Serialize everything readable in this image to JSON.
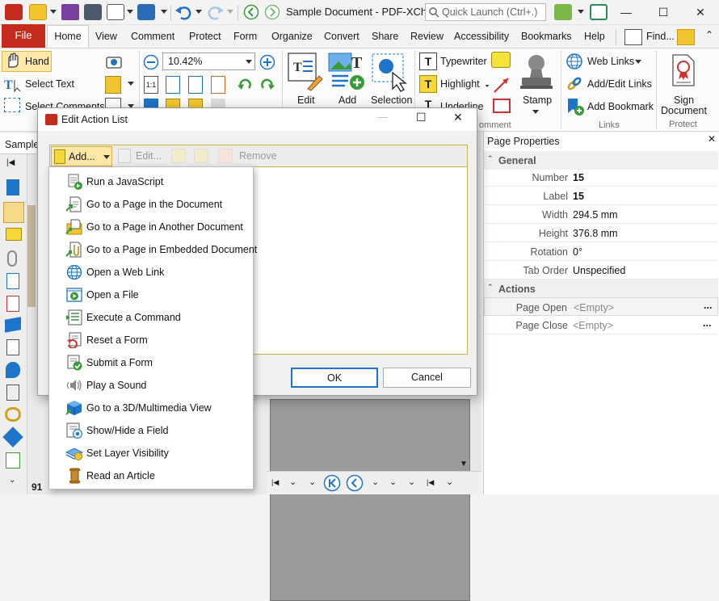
{
  "window": {
    "title": "Sample Document - PDF-XCha...",
    "quick_launch_placeholder": "Quick Launch (Ctrl+.)"
  },
  "menu_tabs": [
    "File",
    "Home",
    "View",
    "Comment",
    "Protect",
    "Form",
    "Organize",
    "Convert",
    "Share",
    "Review",
    "Accessibility",
    "Bookmarks",
    "Help"
  ],
  "find_label": "Find...",
  "ribbon": {
    "hand": "Hand",
    "select_text": "Select Text",
    "select_comments": "Select Comments",
    "zoom_value": "10.42%",
    "edit": "Edit",
    "add": "Add",
    "selection": "Selection",
    "typewriter": "Typewriter",
    "highlight": "Highlight",
    "underline": "Underline",
    "stamp": "Stamp",
    "comment_group": "omment",
    "web_links": "Web Links",
    "add_edit_links": "Add/Edit Links",
    "add_bookmark": "Add Bookmark",
    "links_group": "Links",
    "sign_document_1": "Sign",
    "sign_document_2": "Document",
    "protect_group": "Protect"
  },
  "document": {
    "tab": "Sample",
    "page_count_label": "91"
  },
  "properties": {
    "title": "Page Properties",
    "general_section": "General",
    "rows": [
      {
        "key": "Number",
        "value": "15"
      },
      {
        "key": "Label",
        "value": "15"
      },
      {
        "key": "Width",
        "value": "294.5 mm"
      },
      {
        "key": "Height",
        "value": "376.8 mm"
      },
      {
        "key": "Rotation",
        "value": "0°"
      },
      {
        "key": "Tab Order",
        "value": "Unspecified"
      }
    ],
    "actions_section": "Actions",
    "action_rows": [
      {
        "key": "Page Open",
        "value": "<Empty>"
      },
      {
        "key": "Page Close",
        "value": "<Empty>"
      }
    ],
    "ellipsis": "..."
  },
  "dialog": {
    "title": "Edit Action List",
    "add": "Add...",
    "edit": "Edit...",
    "remove": "Remove",
    "ok": "OK",
    "cancel": "Cancel"
  },
  "add_menu": [
    "Run a JavaScript",
    "Go to a Page in the Document",
    "Go to a Page in Another Document",
    "Go to a Page in Embedded Document",
    "Open a Web Link",
    "Open a File",
    "Execute a Command",
    "Reset a Form",
    "Submit a Form",
    "Play a Sound",
    "Go to a 3D/Multimedia View",
    "Show/Hide a Field",
    "Set Layer Visibility",
    "Read an Article"
  ],
  "colors": {
    "file_tab": "#c42b1c",
    "accent_blue": "#1e74c8",
    "toolbar_border": "#c9b25a"
  }
}
